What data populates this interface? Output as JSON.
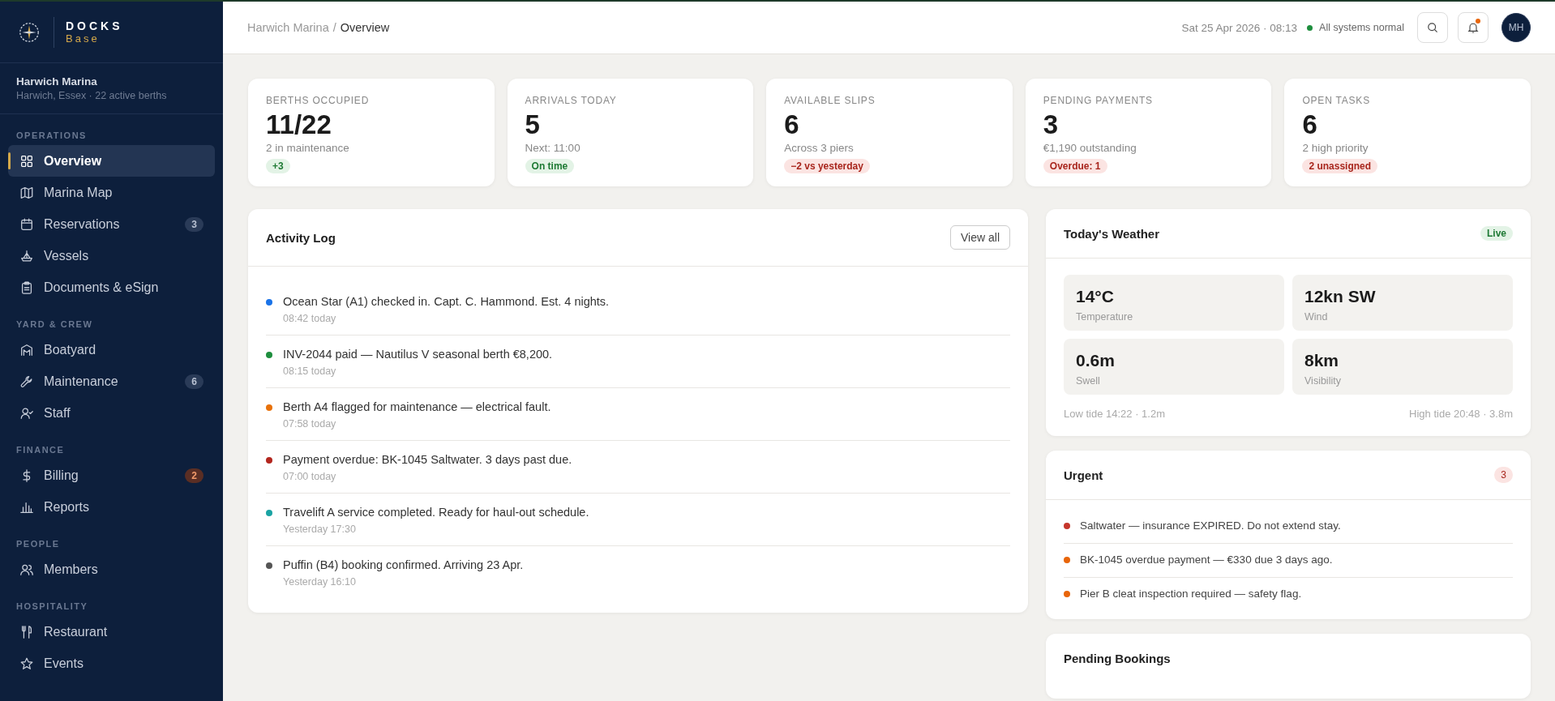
{
  "brand": {
    "name": "DOCKS",
    "sub": "Base"
  },
  "marina": {
    "name": "Harwich Marina",
    "detail": "Harwich, Essex · 22 active berths"
  },
  "nav": [
    {
      "section": "OPERATIONS",
      "items": [
        {
          "label": "Overview",
          "kind": "grid",
          "selected": true
        },
        {
          "label": "Marina Map",
          "kind": "map",
          "selected": false
        },
        {
          "label": "Reservations",
          "kind": "calendar",
          "selected": false,
          "badge": "3",
          "alert": false
        },
        {
          "label": "Vessels",
          "kind": "boat",
          "selected": false
        },
        {
          "label": "Documents & eSign",
          "kind": "clipboard",
          "selected": false
        }
      ]
    },
    {
      "section": "YARD & CREW",
      "items": [
        {
          "label": "Boatyard",
          "kind": "shed",
          "selected": false
        },
        {
          "label": "Maintenance",
          "kind": "wrench",
          "selected": false,
          "badge": "6",
          "alert": false
        },
        {
          "label": "Staff",
          "kind": "usercheck",
          "selected": false
        }
      ]
    },
    {
      "section": "FINANCE",
      "items": [
        {
          "label": "Billing",
          "kind": "dollar",
          "selected": false,
          "badge": "2",
          "alert": true
        },
        {
          "label": "Reports",
          "kind": "chart",
          "selected": false
        }
      ]
    },
    {
      "section": "PEOPLE",
      "items": [
        {
          "label": "Members",
          "kind": "users",
          "selected": false
        }
      ]
    },
    {
      "section": "HOSPITALITY",
      "items": [
        {
          "label": "Restaurant",
          "kind": "utensils",
          "selected": false
        },
        {
          "label": "Events",
          "kind": "star",
          "selected": false
        }
      ]
    }
  ],
  "breadcrumb": {
    "parent": "Harwich Marina",
    "separator": "/",
    "current": "Overview"
  },
  "topbar": {
    "datetime": "Sat 25 Apr 2026 · 08:13",
    "status": "All systems normal",
    "avatar": "MH",
    "notifications_unread": true
  },
  "stats": [
    {
      "label": "BERTHS OCCUPIED",
      "value": "11/22",
      "sub": "2 in maintenance",
      "badge": "+3",
      "alert": false
    },
    {
      "label": "ARRIVALS TODAY",
      "value": "5",
      "sub": "Next: 11:00",
      "badge": "On time",
      "alert": false
    },
    {
      "label": "AVAILABLE SLIPS",
      "value": "6",
      "sub": "Across 3 piers",
      "badge": "−2 vs yesterday",
      "alert": true
    },
    {
      "label": "PENDING PAYMENTS",
      "value": "3",
      "sub": "€1,190 outstanding",
      "badge": "Overdue: 1",
      "alert": true
    },
    {
      "label": "OPEN TASKS",
      "value": "6",
      "sub": "2 high priority",
      "badge": "2 unassigned",
      "alert": true
    }
  ],
  "activity": {
    "title": "Activity Log",
    "button": "View all",
    "items": [
      {
        "text": "Ocean Star (A1) checked in. Capt. C. Hammond. Est. 4 nights.",
        "time": "08:42 today",
        "color": "#1a73e8"
      },
      {
        "text": "INV-2044 paid — Nautilus V seasonal berth €8,200.",
        "time": "08:15 today",
        "color": "#1e8e3e"
      },
      {
        "text": "Berth A4 flagged for maintenance — electrical fault.",
        "time": "07:58 today",
        "color": "#e8710a"
      },
      {
        "text": "Payment overdue: BK-1045 Saltwater. 3 days past due.",
        "time": "07:00 today",
        "color": "#b3261e"
      },
      {
        "text": "Travelift A service completed. Ready for haul-out schedule.",
        "time": "Yesterday 17:30",
        "color": "#1aa3a3"
      },
      {
        "text": "Puffin (B4) booking confirmed. Arriving 23 Apr.",
        "time": "Yesterday 16:10",
        "color": "#555555"
      }
    ]
  },
  "weather": {
    "title": "Today's Weather",
    "badge": "Live",
    "tiles": [
      {
        "value": "14°C",
        "label": "Temperature"
      },
      {
        "value": "12kn SW",
        "label": "Wind"
      },
      {
        "value": "0.6m",
        "label": "Swell"
      },
      {
        "value": "8km",
        "label": "Visibility"
      }
    ],
    "low_tide": "Low tide 14:22 · 1.2m",
    "high_tide": "High tide 20:48 · 3.8m"
  },
  "urgent": {
    "title": "Urgent",
    "count": "3",
    "items": [
      {
        "text": "Saltwater — insurance EXPIRED. Do not extend stay.",
        "color": "#c5362b"
      },
      {
        "text": "BK-1045 overdue payment — €330 due 3 days ago.",
        "color": "#e8650a"
      },
      {
        "text": "Pier B cleat inspection required — safety flag.",
        "color": "#e8650a"
      }
    ]
  },
  "pending_bookings": {
    "title": "Pending Bookings"
  }
}
